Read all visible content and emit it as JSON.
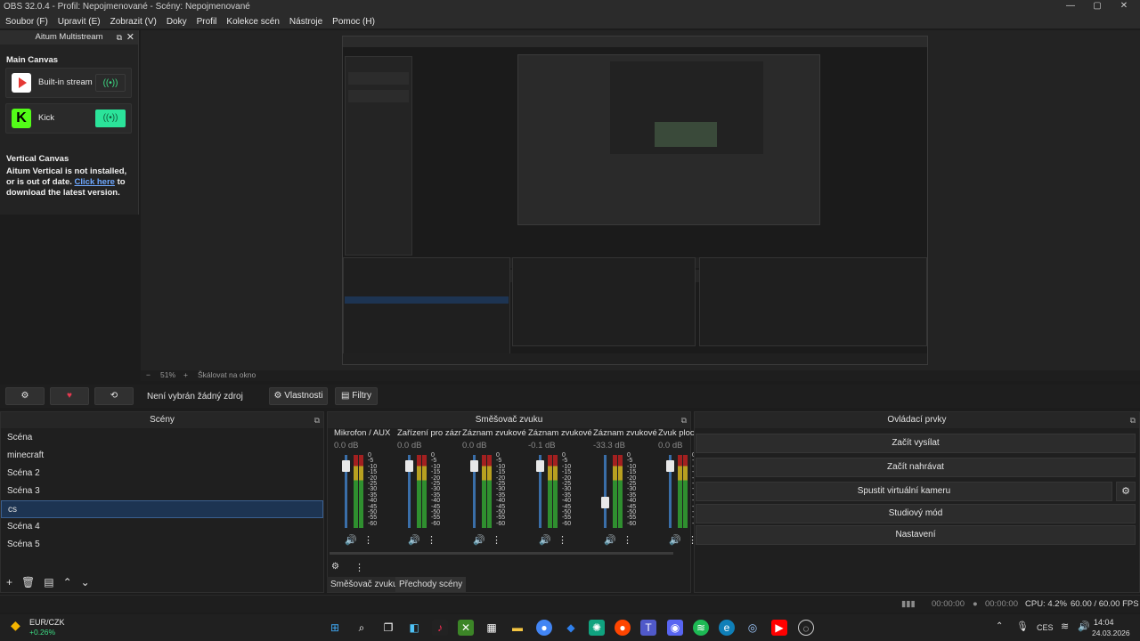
{
  "window": {
    "title": "OBS 32.0.4 - Profil: Nepojmenované - Scény: Nepojmenované",
    "controls": [
      "—",
      "▢",
      "✕"
    ]
  },
  "menu": [
    "Soubor (F)",
    "Upravit (E)",
    "Zobrazit (V)",
    "Doky",
    "Profil",
    "Kolekce scén",
    "Nástroje",
    "Pomoc (H)"
  ],
  "multistream": {
    "title": "Aitum Multistream",
    "main_canvas": "Main Canvas",
    "services": [
      {
        "label": "Built-in stream",
        "color": "#e53935"
      },
      {
        "label": "Kick",
        "color": "#53fc18"
      }
    ],
    "vertical_canvas": "Vertical Canvas",
    "vertical_msg": "Aitum Vertical is not installed, or is out of date.",
    "click_here": "Click here",
    "download_msg": "to download the latest version."
  },
  "preview": {
    "zoom": "51%",
    "scale_label": "Škálovat na okno"
  },
  "source_toolbar": {
    "no_source": "Není vybrán žádný zdroj",
    "properties": "Vlastnosti",
    "filters": "Filtry"
  },
  "scenes": {
    "title": "Scény",
    "items": [
      "Scéna",
      "minecraft",
      "Scéna 2",
      "Scéna 3",
      "cs",
      "Scéna 4",
      "Scéna 5"
    ],
    "selected_index": 4
  },
  "mixer": {
    "title": "Směšovač zvuku",
    "channels": [
      {
        "name": "Mikrofon / AUX",
        "db": "0.0 dB",
        "level": 0.85
      },
      {
        "name": "Zařízení pro záznam",
        "db": "0.0 dB",
        "level": 0.85
      },
      {
        "name": "Záznam zvukové",
        "db": "0.0 dB",
        "level": 0.85
      },
      {
        "name": "Záznam zvukové",
        "db": "-0.1 dB",
        "level": 0.85
      },
      {
        "name": "Záznam zvukové",
        "db": "-33.3 dB",
        "level": 0.35
      },
      {
        "name": "Zvuk ploc",
        "db": "0.0 dB",
        "level": 0.85
      }
    ],
    "scale": [
      "0",
      "-5",
      "-10",
      "-15",
      "-20",
      "-25",
      "-30",
      "-35",
      "-40",
      "-45",
      "-50",
      "-55",
      "-60"
    ],
    "tabs": [
      "Směšovač zvuku",
      "Přechody scény"
    ]
  },
  "controls": {
    "title": "Ovládací prvky",
    "buttons": [
      "Začít vysílat",
      "Začít nahrávat",
      "Spustit virtuální kameru",
      "Studiový mód",
      "Nastavení"
    ]
  },
  "status": {
    "stream_time": "00:00:00",
    "rec_time": "00:00:00",
    "cpu": "CPU: 4.2%",
    "fps": "60.00 / 60.00 FPS"
  },
  "taskbar": {
    "ticker_name": "EUR/CZK",
    "ticker_change": "+0.26%",
    "lang": "CES",
    "time": "14:04",
    "date": "24.03.2026"
  }
}
